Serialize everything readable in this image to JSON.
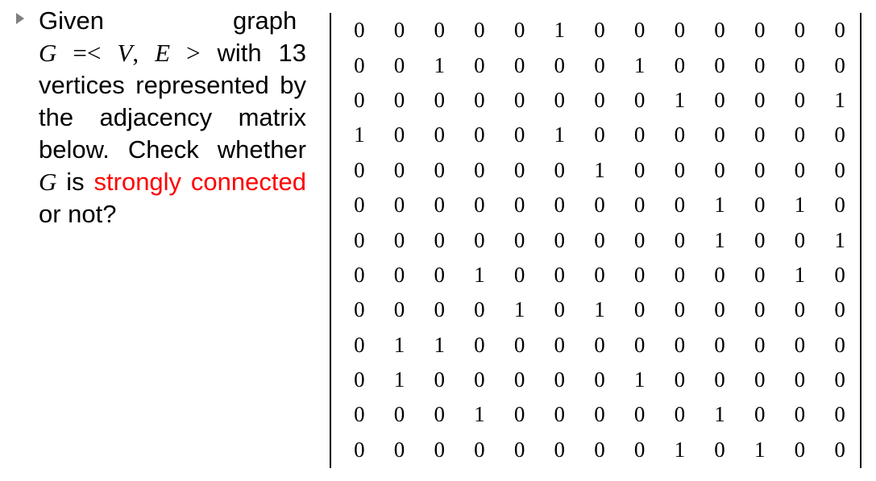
{
  "question": {
    "w_given": "Given",
    "w_graph": "graph",
    "math_g": "G",
    "math_eq": " =< ",
    "math_v": "V",
    "math_comma": ", ",
    "math_e": "E",
    "math_gt": " >",
    "w_with": " with 13 vertices represented by the adjacency matrix below. Check whether ",
    "math_g2": "G",
    "w_is": " is ",
    "highlight": "strongly connected",
    "w_end": " or not?",
    "highlight_color": "#ff0000"
  },
  "matrix": {
    "rows": [
      [
        0,
        0,
        0,
        0,
        0,
        1,
        0,
        0,
        0,
        0,
        0,
        0,
        0
      ],
      [
        0,
        0,
        1,
        0,
        0,
        0,
        0,
        1,
        0,
        0,
        0,
        0,
        0
      ],
      [
        0,
        0,
        0,
        0,
        0,
        0,
        0,
        0,
        1,
        0,
        0,
        0,
        1
      ],
      [
        1,
        0,
        0,
        0,
        0,
        1,
        0,
        0,
        0,
        0,
        0,
        0,
        0
      ],
      [
        0,
        0,
        0,
        0,
        0,
        0,
        1,
        0,
        0,
        0,
        0,
        0,
        0
      ],
      [
        0,
        0,
        0,
        0,
        0,
        0,
        0,
        0,
        0,
        1,
        0,
        1,
        0
      ],
      [
        0,
        0,
        0,
        0,
        0,
        0,
        0,
        0,
        0,
        1,
        0,
        0,
        1
      ],
      [
        0,
        0,
        0,
        1,
        0,
        0,
        0,
        0,
        0,
        0,
        0,
        1,
        0
      ],
      [
        0,
        0,
        0,
        0,
        1,
        0,
        1,
        0,
        0,
        0,
        0,
        0,
        0
      ],
      [
        0,
        1,
        1,
        0,
        0,
        0,
        0,
        0,
        0,
        0,
        0,
        0,
        0
      ],
      [
        0,
        1,
        0,
        0,
        0,
        0,
        0,
        1,
        0,
        0,
        0,
        0,
        0
      ],
      [
        0,
        0,
        0,
        1,
        0,
        0,
        0,
        0,
        0,
        1,
        0,
        0,
        0
      ],
      [
        0,
        0,
        0,
        0,
        0,
        0,
        0,
        0,
        1,
        0,
        1,
        0,
        0
      ]
    ]
  }
}
